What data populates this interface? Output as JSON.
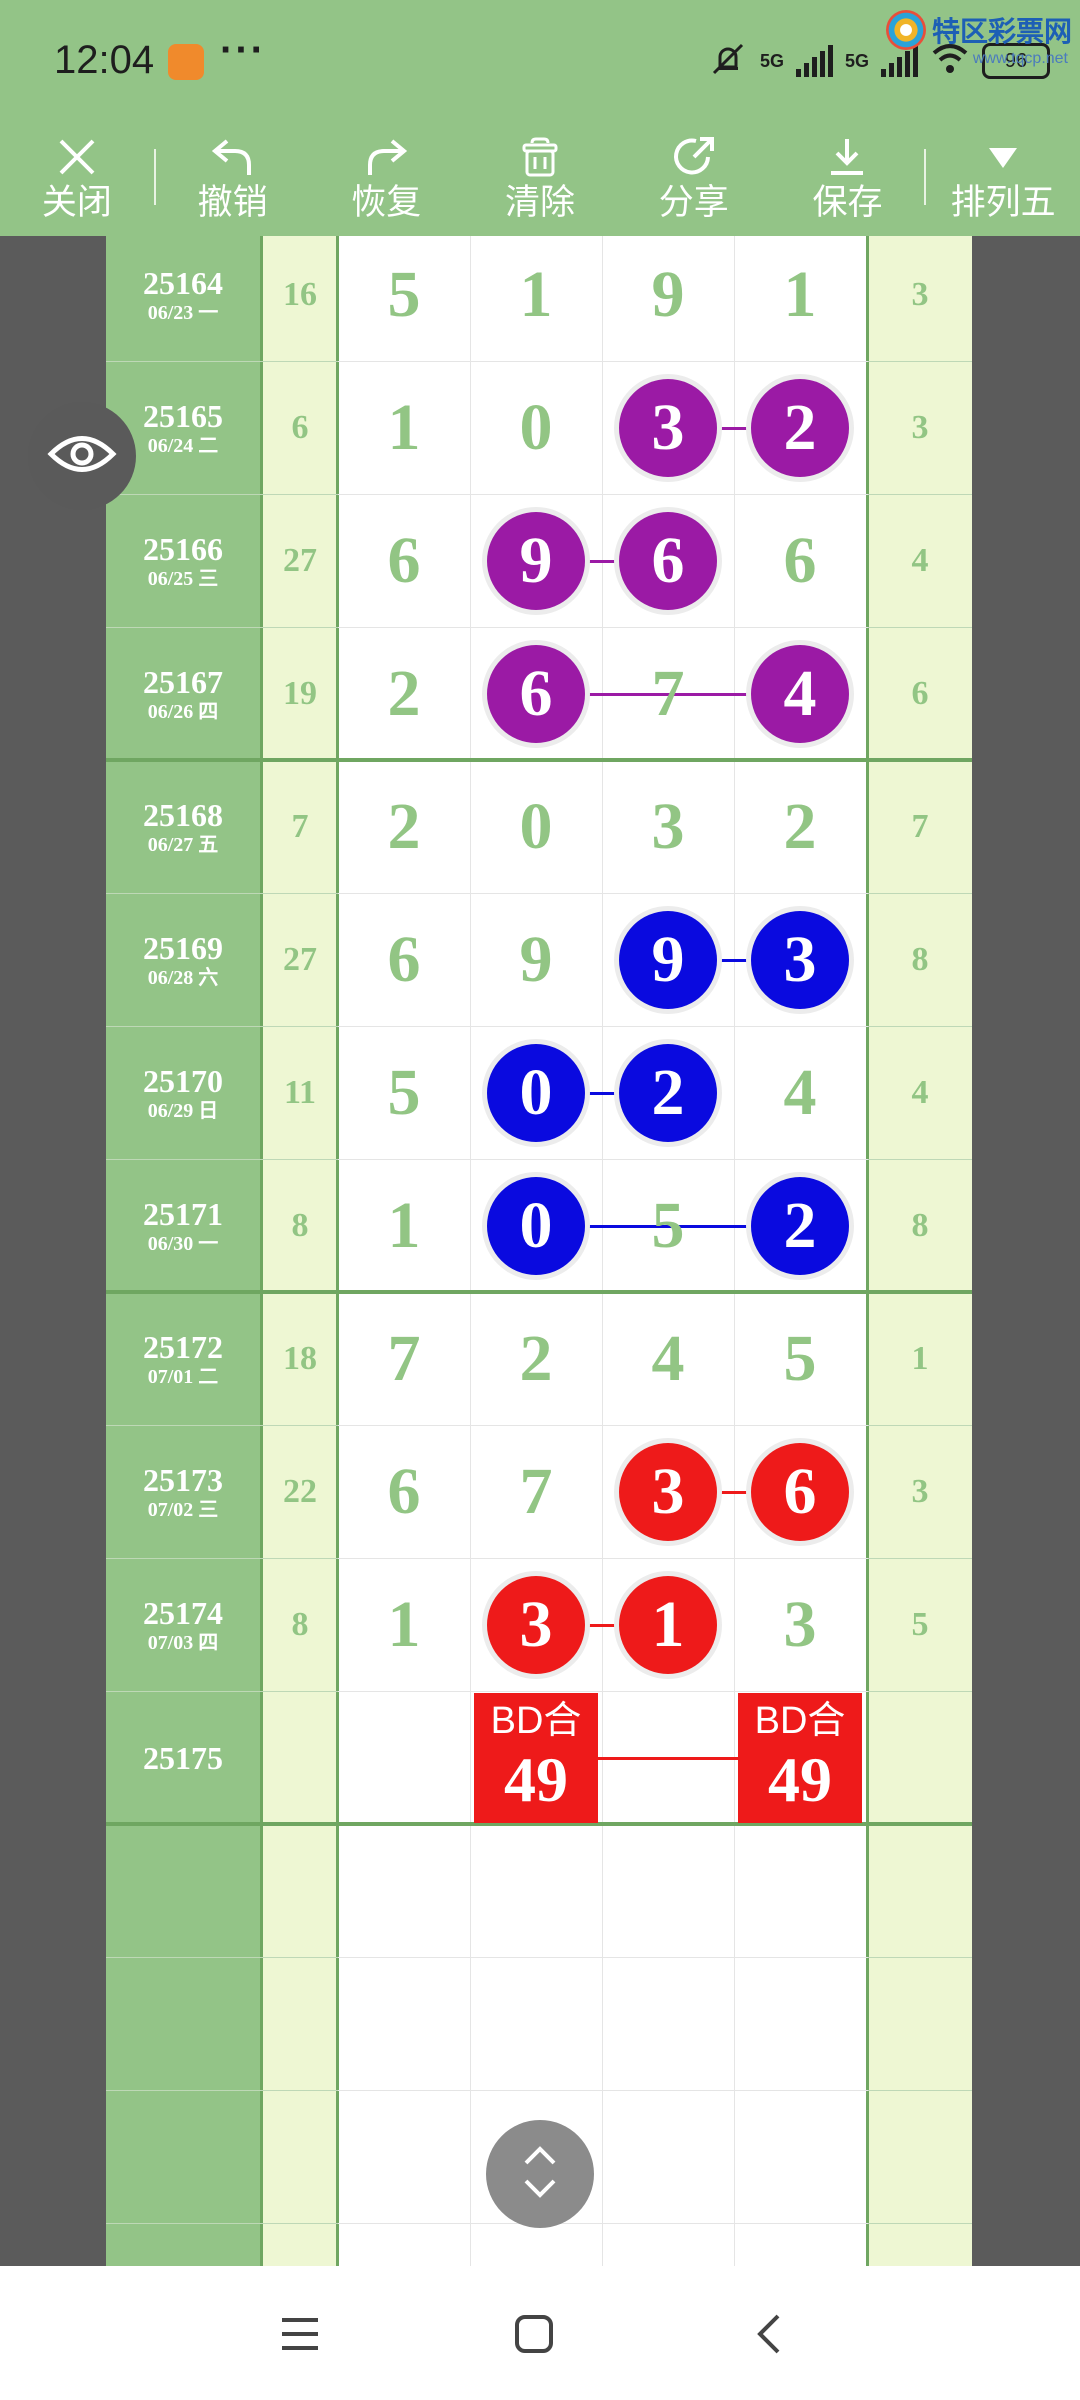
{
  "status_bar": {
    "time": "12:04",
    "more": "···",
    "net1": "5G",
    "net2": "5G",
    "battery": "96",
    "watermark_name": "特区彩票网",
    "watermark_url": "www.tqcp.net"
  },
  "toolbar": {
    "close": "关闭",
    "undo": "撤销",
    "redo": "恢复",
    "clear": "清除",
    "share": "分享",
    "save": "保存",
    "mode": "排列五"
  },
  "rows": [
    {
      "period": "25164",
      "date": "06/23 一",
      "sum": "16",
      "digits": [
        "5",
        "1",
        "9",
        "1"
      ],
      "right": "3"
    },
    {
      "period": "25165",
      "date": "06/24 二",
      "sum": "6",
      "digits": [
        "1",
        "0",
        "3",
        "2"
      ],
      "right": "3"
    },
    {
      "period": "25166",
      "date": "06/25 三",
      "sum": "27",
      "digits": [
        "6",
        "9",
        "6",
        "6"
      ],
      "right": "4"
    },
    {
      "period": "25167",
      "date": "06/26 四",
      "sum": "19",
      "digits": [
        "2",
        "6",
        "7",
        "4"
      ],
      "right": "6"
    },
    {
      "period": "25168",
      "date": "06/27 五",
      "sum": "7",
      "digits": [
        "2",
        "0",
        "3",
        "2"
      ],
      "right": "7"
    },
    {
      "period": "25169",
      "date": "06/28 六",
      "sum": "27",
      "digits": [
        "6",
        "9",
        "9",
        "3"
      ],
      "right": "8"
    },
    {
      "period": "25170",
      "date": "06/29 日",
      "sum": "11",
      "digits": [
        "5",
        "0",
        "2",
        "4"
      ],
      "right": "4"
    },
    {
      "period": "25171",
      "date": "06/30 一",
      "sum": "8",
      "digits": [
        "1",
        "0",
        "5",
        "2"
      ],
      "right": "8"
    },
    {
      "period": "25172",
      "date": "07/01 二",
      "sum": "18",
      "digits": [
        "7",
        "2",
        "4",
        "5"
      ],
      "right": "1"
    },
    {
      "period": "25173",
      "date": "07/02 三",
      "sum": "22",
      "digits": [
        "6",
        "7",
        "3",
        "6"
      ],
      "right": "3"
    },
    {
      "period": "25174",
      "date": "07/03 四",
      "sum": "8",
      "digits": [
        "1",
        "3",
        "1",
        "3"
      ],
      "right": "5"
    },
    {
      "period": "25175",
      "date": "",
      "sum": "",
      "digits": [
        "",
        "",
        "",
        ""
      ],
      "right": ""
    }
  ],
  "highlights": [
    {
      "row": 1,
      "col": 2,
      "color": "#9b1aa5"
    },
    {
      "row": 1,
      "col": 3,
      "color": "#9b1aa5"
    },
    {
      "row": 2,
      "col": 1,
      "color": "#9b1aa5"
    },
    {
      "row": 2,
      "col": 2,
      "color": "#9b1aa5"
    },
    {
      "row": 3,
      "col": 1,
      "color": "#9b1aa5"
    },
    {
      "row": 3,
      "col": 3,
      "color": "#9b1aa5"
    },
    {
      "row": 5,
      "col": 2,
      "color": "#0a0adf"
    },
    {
      "row": 5,
      "col": 3,
      "color": "#0a0adf"
    },
    {
      "row": 6,
      "col": 1,
      "color": "#0a0adf"
    },
    {
      "row": 6,
      "col": 2,
      "color": "#0a0adf"
    },
    {
      "row": 7,
      "col": 1,
      "color": "#0a0adf"
    },
    {
      "row": 7,
      "col": 3,
      "color": "#0a0adf"
    },
    {
      "row": 9,
      "col": 2,
      "color": "#ee1a1a"
    },
    {
      "row": 9,
      "col": 3,
      "color": "#ee1a1a"
    },
    {
      "row": 10,
      "col": 1,
      "color": "#ee1a1a"
    },
    {
      "row": 10,
      "col": 2,
      "color": "#ee1a1a"
    }
  ],
  "connectors": [
    {
      "row": 1,
      "from": 2,
      "to": 3,
      "color": "#9b1aa5"
    },
    {
      "row": 2,
      "from": 1,
      "to": 2,
      "color": "#9b1aa5"
    },
    {
      "row": 3,
      "from": 1,
      "to": 3,
      "color": "#9b1aa5"
    },
    {
      "row": 5,
      "from": 2,
      "to": 3,
      "color": "#0a0adf"
    },
    {
      "row": 6,
      "from": 1,
      "to": 2,
      "color": "#0a0adf"
    },
    {
      "row": 7,
      "from": 1,
      "to": 3,
      "color": "#0a0adf"
    },
    {
      "row": 9,
      "from": 2,
      "to": 3,
      "color": "#ee1a1a"
    },
    {
      "row": 10,
      "from": 1,
      "to": 2,
      "color": "#ee1a1a"
    },
    {
      "row": 11,
      "from": 1,
      "to": 3,
      "color": "#ee1a1a"
    }
  ],
  "predictions": [
    {
      "row": 11,
      "col": 1,
      "label": "BD合",
      "value": "49",
      "color": "#ee1a1a"
    },
    {
      "row": 11,
      "col": 3,
      "label": "BD合",
      "value": "49",
      "color": "#ee1a1a"
    }
  ],
  "colors": {
    "header_green": "#93c487",
    "digit_green": "#92c584",
    "light_col": "#eef7d3"
  }
}
